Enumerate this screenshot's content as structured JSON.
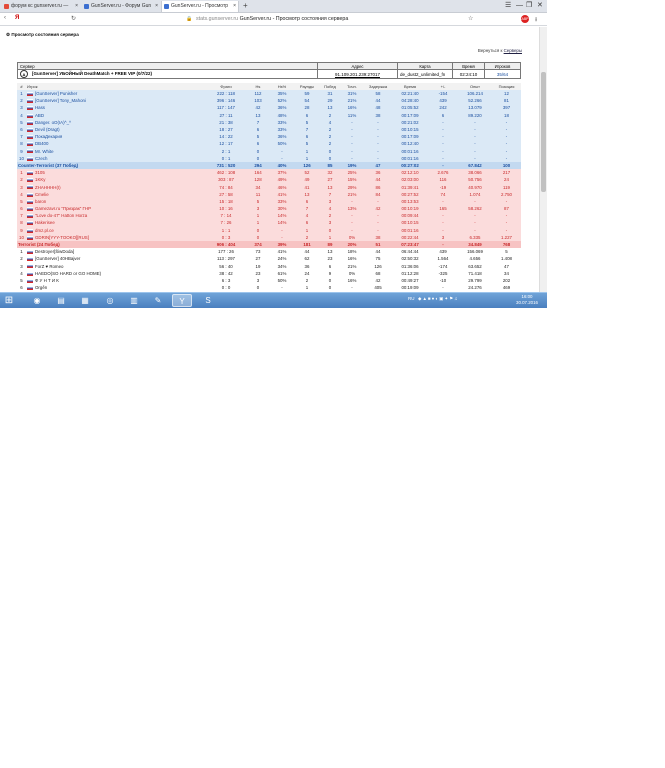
{
  "browser": {
    "tabs": [
      {
        "label": "форум кс gunserver.ru — ",
        "color": "#e34b3a"
      },
      {
        "label": "GunServer.ru - Форум Gun",
        "color": "#3b6fd0"
      },
      {
        "label": "GunServer.ru - Просмотр",
        "color": "#3b6fd0"
      }
    ],
    "new_tab": "+",
    "address": {
      "domain": "stats.gunserver.ru",
      "title": "GunServer.ru - Просмотр состояния сервера"
    },
    "window_controls": [
      "☰",
      "—",
      "❐",
      "✕"
    ]
  },
  "page": {
    "header": "Просмотр состояния сервера",
    "back_prefix": "Вернуться к",
    "back_link": "Серверы",
    "info_headers": [
      "Сервер",
      "Адрес",
      "Карта",
      "Время",
      "Игроков"
    ],
    "info": {
      "server": "[GunServer] УБОЙНЫЙ DeathMatch + FREE VIP (0/7/22)",
      "address": "91.109.201.239:27017",
      "map": "de_dust2_unlimited_fn",
      "time": "02:24:10",
      "players": "35/64"
    },
    "columns": [
      "#",
      "Игрок",
      "Фраги",
      "Hs",
      "Hs%",
      "Раунды",
      "Побед",
      "Точн.",
      "Задержка",
      "Время",
      "+/-",
      "Опыт",
      "Позиция"
    ],
    "ct_players": [
      [
        "1",
        "[GunServer] Punisher",
        "222 : 118",
        "112",
        "35%",
        "59",
        "31",
        "31%",
        "58",
        "02:21:40",
        "-154",
        "106.214",
        "12"
      ],
      [
        "2",
        "[GunServer] Tony_Mahoni",
        "396 : 146",
        "103",
        "52%",
        "54",
        "29",
        "21%",
        "44",
        "04:28:40",
        "439",
        "52.266",
        "81"
      ],
      [
        "3",
        "Hass",
        "117 : 147",
        "42",
        "36%",
        "28",
        "13",
        "16%",
        "48",
        "01:05:52",
        "242",
        "13.079",
        "397"
      ],
      [
        "4",
        "ABD",
        "27 : 11",
        "13",
        "48%",
        "6",
        "2",
        "11%",
        "38",
        "00:17:09",
        "6",
        "89.220",
        "18"
      ],
      [
        "5",
        "Danger. oO(IA)^_^",
        "21 : 38",
        "7",
        "33%",
        "5",
        "4",
        "-",
        "-",
        "00:21:02",
        "-",
        "-",
        "-"
      ],
      [
        "6",
        "Devil (Dragt)",
        "18 : 27",
        "6",
        "33%",
        "7",
        "2",
        "-",
        "-",
        "00:10:15",
        "-",
        "-",
        "-"
      ],
      [
        "7",
        "ПокаДекария",
        "14 : 22",
        "5",
        "36%",
        "6",
        "2",
        "-",
        "-",
        "00:17:09",
        "-",
        "-",
        "-"
      ],
      [
        "8",
        "DB400",
        "12 : 17",
        "6",
        "50%",
        "5",
        "2",
        "-",
        "-",
        "00:12:40",
        "-",
        "-",
        "-"
      ],
      [
        "9",
        "Mr. White",
        "2 : 1",
        "0",
        "-",
        "1",
        "0",
        "-",
        "-",
        "00:01:16",
        "-",
        "-",
        "-"
      ],
      [
        "10",
        "Czech",
        "0 : 1",
        "0",
        "-",
        "1",
        "0",
        "-",
        "-",
        "00:01:16",
        "-",
        "-",
        "-"
      ]
    ],
    "ct_team": [
      "Counter-Terrorist",
      "(37 Побед)",
      "731 : 520",
      "294",
      "40%",
      "126",
      "85",
      "19%",
      "47",
      "00:27:02",
      "-",
      "67.842",
      "100"
    ],
    "t_players": [
      [
        "1",
        "3105",
        "462 : 108",
        "164",
        "37%",
        "52",
        "32",
        "25%",
        "36",
        "02:12:10",
        "2.676",
        "38.066",
        "217"
      ],
      [
        "2",
        "1KKy",
        "303 : 87",
        "128",
        "49%",
        "49",
        "27",
        "15%",
        "44",
        "02:03:00",
        "116",
        "50.756",
        "24"
      ],
      [
        "3",
        "ZHAHHHH(I)",
        "74 : 84",
        "34",
        "46%",
        "41",
        "13",
        "29%",
        "86",
        "01:39:41",
        "-19",
        "40.970",
        "119"
      ],
      [
        "4",
        "Cmelie",
        "27 : 58",
        "11",
        "41%",
        "13",
        "7",
        "21%",
        "84",
        "00:27:52",
        "74",
        "1.074",
        "2.750"
      ],
      [
        "5",
        "baron",
        "15 : 18",
        "5",
        "33%",
        "6",
        "3",
        "-",
        "-",
        "00:13:53",
        "-",
        "-",
        "-"
      ],
      [
        "6",
        "Gamezavr.ru \"Призрак\" ГНР",
        "10 : 16",
        "3",
        "30%",
        "7",
        "4",
        "13%",
        "42",
        "00:10:19",
        "165",
        "58.262",
        "87"
      ],
      [
        "7",
        "\"Love do-47\" Hatton Horza",
        "7 : 14",
        "1",
        "14%",
        "4",
        "2",
        "-",
        "-",
        "00:09:44",
        "-",
        "-",
        "-"
      ],
      [
        "8",
        "Hakerisee",
        "7 : 26",
        "1",
        "14%",
        "6",
        "3",
        "-",
        "-",
        "00:10:15",
        "-",
        "-",
        "-"
      ],
      [
        "9",
        "dmz.pl.ce",
        "1 : 1",
        "0",
        "-",
        "1",
        "0",
        "-",
        "-",
        "00:01:16",
        "-",
        "-",
        "-"
      ],
      [
        "10",
        "GDRIN[YYY-TOOKO][RUS]",
        "0 : 3",
        "0",
        "-",
        "2",
        "1",
        "0%",
        "38",
        "00:22:44",
        "3",
        "6.335",
        "1.227"
      ]
    ],
    "t_team": [
      "Terrorist",
      "(24 Побед)",
      "906 : 404",
      "374",
      "39%",
      "181",
      "89",
      "20%",
      "51",
      "07:23:47",
      "-",
      "34.849",
      "768"
    ],
    "sp_players": [
      [
        "1",
        "Destroyer[ŠiwDoda]",
        "177 : 26",
        "73",
        "41%",
        "44",
        "13",
        "18%",
        "44",
        "06:44:44",
        "439",
        "156.069",
        "5"
      ],
      [
        "2",
        "[GunServer] 40HBajver",
        "113 : 297",
        "27",
        "24%",
        "62",
        "23",
        "16%",
        "75",
        "02:50:32",
        "1.564",
        "4.656",
        "1.408"
      ],
      [
        "3",
        "ForZ ♥ Romeo",
        "56 : 40",
        "19",
        "34%",
        "36",
        "6",
        "21%",
        "126",
        "01:36:06",
        "-174",
        "63.652",
        "47"
      ],
      [
        "4",
        "HAEDO(SO HARD or GO HOME)",
        "38 : 42",
        "23",
        "61%",
        "24",
        "9",
        "0%",
        "68",
        "01:12:28",
        "-325",
        "71.418",
        "34"
      ],
      [
        "5",
        "Ф У Н Т И К",
        "6 : 3",
        "3",
        "50%",
        "2",
        "0",
        "16%",
        "42",
        "00:49:27",
        "-10",
        "29.799",
        "202"
      ],
      [
        "6",
        "Orgěn",
        "0 : 0",
        "0",
        "-",
        "1",
        "0",
        "-",
        "405",
        "00:19:09",
        "-",
        "24.276",
        "469"
      ]
    ]
  },
  "taskbar": {
    "apps": [
      {
        "name": "windows-start-icon",
        "glyph": "⊞"
      },
      {
        "name": "chrome-icon",
        "glyph": "◉"
      },
      {
        "name": "explorer-folder-icon",
        "glyph": "▤"
      },
      {
        "name": "files-icon",
        "glyph": "▦"
      },
      {
        "name": "steam-icon",
        "glyph": "◎"
      },
      {
        "name": "winrar-icon",
        "glyph": "▥"
      },
      {
        "name": "tool-icon",
        "glyph": "✎"
      },
      {
        "name": "yandex-browser-icon",
        "glyph": "Y"
      },
      {
        "name": "skype-icon",
        "glyph": "S"
      }
    ],
    "lang": "RU",
    "time": "16:00",
    "date": "30.07.2016"
  },
  "colors": {
    "ct": "#1a4fa0",
    "t": "#c8282a",
    "taskbar": "#4a7fbf"
  }
}
